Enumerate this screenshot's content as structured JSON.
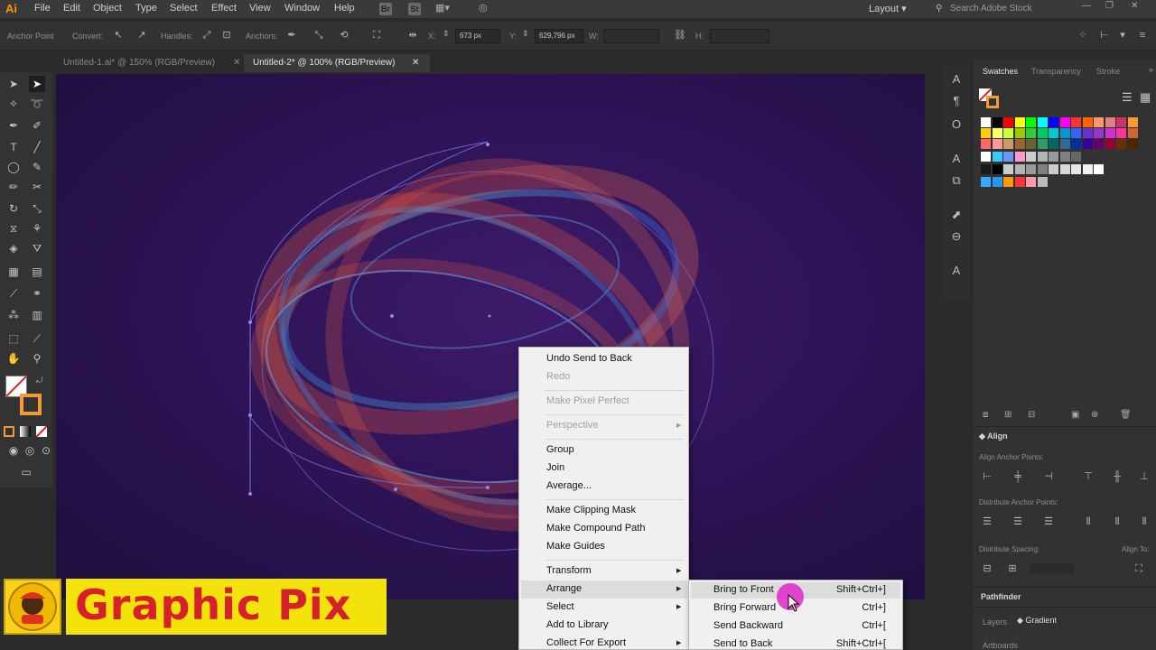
{
  "app": {
    "logo": "Ai"
  },
  "menubar": {
    "items": [
      "File",
      "Edit",
      "Object",
      "Type",
      "Select",
      "Effect",
      "View",
      "Window",
      "Help"
    ],
    "bridge_badge": "Br",
    "stock_badge": "St",
    "workspace": "Layout",
    "search_placeholder": "Search Adobe Stock"
  },
  "controlbar": {
    "anchor_point": "Anchor Point",
    "convert": "Convert:",
    "handles": "Handles:",
    "anchors": "Anchors:",
    "x_label": "X:",
    "x_value": "673 px",
    "y_label": "Y:",
    "y_value": "629,796 px",
    "w_label": "W:",
    "h_label": "H:"
  },
  "tabs": [
    {
      "label": "Untitled-1.ai* @ 150% (RGB/Preview)",
      "active": false
    },
    {
      "label": "Untitled-2* @ 100% (RGB/Preview)",
      "active": true
    }
  ],
  "right_panel": {
    "tabs": [
      "Swatches",
      "Transparency",
      "Stroke"
    ],
    "align_title": "Align",
    "align_anchor_points": "Align Anchor Points:",
    "distribute_anchor_points": "Distribute Anchor Points:",
    "distribute_spacing": "Distribute Spacing:",
    "align_to": "Align To:",
    "pathfinder_title": "Pathfinder",
    "layers_tab": "Layers",
    "gradient_tab": "Gradient",
    "artboards_tab": "Artboards"
  },
  "swatch_colors": [
    [
      "#ffffff",
      "#000000",
      "#ff0000",
      "#ffff00",
      "#00ff00",
      "#00ffff",
      "#0000ff",
      "#ff00ff",
      "#ff3333",
      "#ff6600",
      "#ff9966",
      "#e08080",
      "#cc3366",
      "#ff9933"
    ],
    [
      "#ffcc00",
      "#ffff66",
      "#ccff33",
      "#99cc00",
      "#33cc33",
      "#00cc66",
      "#00cccc",
      "#0099cc",
      "#3366ff",
      "#6633cc",
      "#9933cc",
      "#cc33cc",
      "#ff3399",
      "#cc6633"
    ],
    [
      "#ff6666",
      "#ff9999",
      "#cc9966",
      "#996633",
      "#666633",
      "#339966",
      "#006666",
      "#336699",
      "#003399",
      "#330099",
      "#660066",
      "#990033",
      "#663300",
      "#4d2600"
    ],
    [
      "#ffffff",
      "#33ccff",
      "#6699ff",
      "#ff99cc",
      "#cccccc",
      "#b3b3b3",
      "#999999",
      "#808080",
      "#666666"
    ],
    [
      "#1a1a1a",
      "#000000",
      "#cccccc",
      "#b3b3b3",
      "#999999",
      "#808080",
      "#cccccc",
      "#d9d9d9",
      "#e6e6e6",
      "#f2f2f2",
      "#ffffff"
    ],
    [
      "#33aaff",
      "#2299ee",
      "#ff9900",
      "#ff3333",
      "#ff99aa",
      "#bbbbbb"
    ]
  ],
  "context_menu": {
    "undo": "Undo Send to Back",
    "redo": "Redo",
    "make_pixel_perfect": "Make Pixel Perfect",
    "perspective": "Perspective",
    "group": "Group",
    "join": "Join",
    "average": "Average...",
    "make_clipping_mask": "Make Clipping Mask",
    "make_compound_path": "Make Compound Path",
    "make_guides": "Make Guides",
    "transform": "Transform",
    "arrange": "Arrange",
    "select": "Select",
    "add_to_library": "Add to Library",
    "collect_for_export": "Collect For Export"
  },
  "arrange_submenu": [
    {
      "label": "Bring to Front",
      "shortcut": "Shift+Ctrl+]"
    },
    {
      "label": "Bring Forward",
      "shortcut": "Ctrl+]"
    },
    {
      "label": "Send Backward",
      "shortcut": "Ctrl+["
    },
    {
      "label": "Send to Back",
      "shortcut": "Shift+Ctrl+["
    }
  ],
  "watermark": {
    "text": "Graphic Pix",
    "badge_text": "GraphicPix"
  }
}
